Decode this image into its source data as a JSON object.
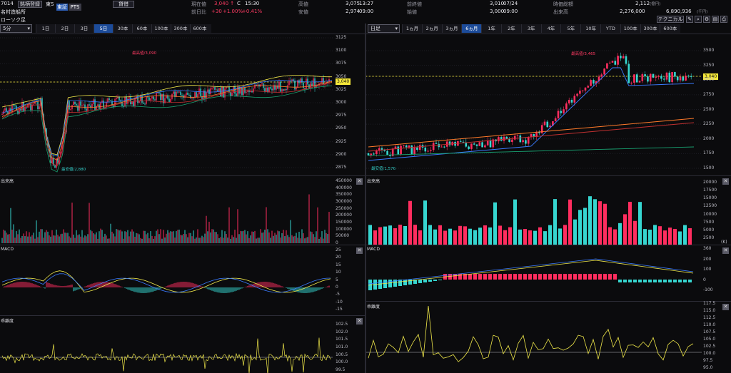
{
  "header": {
    "code": "7014",
    "company": "名村造船所",
    "register_button": "銘柄登録",
    "exchange": "東S",
    "market_tag": "東証",
    "pts_tag": "PTS",
    "lend_button": "貸借",
    "chart_type_label": "ローソク足",
    "fields": {
      "current_label": "現在値",
      "current_value": "3,040 ↑",
      "current_time_code": "C",
      "current_time": "15:30",
      "change_label": "前日比",
      "change_value": "+30",
      "change_pct": "+1.00%",
      "change_pct2": "+0.41%",
      "high_label": "高値",
      "high_value": "3,075",
      "high_time": "13:27",
      "low_label": "安値",
      "low_value": "2,974",
      "low_time": "09:00",
      "prev_label": "前終値",
      "prev_value": "3,010",
      "prev_date": "07/24",
      "open_label": "始値",
      "open_value": "3,000",
      "open_time": "09:00",
      "mcap_label": "時価総額",
      "mcap_value": "2,112",
      "mcap_unit": "(億円)",
      "volume_label": "出来高",
      "volume_value": "2,276,000",
      "turnover_value": "6,890,936",
      "turnover_unit": "(千円)",
      "technical_button": "テクニカル"
    }
  },
  "left": {
    "interval_select": "5分",
    "periods": [
      "1日",
      "2日",
      "3日",
      "5日",
      "30本",
      "60本",
      "100本",
      "300本",
      "600本"
    ],
    "active_period": "5日",
    "price_ticks": [
      "3125",
      "3100",
      "3075",
      "3050",
      "3025",
      "3000",
      "2975",
      "2950",
      "2925",
      "2900",
      "2875"
    ],
    "high_annotation": "最高値/3,090",
    "low_annotation": "最安値/2,880",
    "current_tag": "3,040",
    "volume_title": "出来高",
    "volume_ticks": [
      "450000",
      "400000",
      "350000",
      "300000",
      "250000",
      "200000",
      "150000",
      "100000",
      "50000",
      "0"
    ],
    "macd_title": "MACD",
    "macd_ticks": [
      "25",
      "20",
      "15",
      "10",
      "5",
      "0",
      "-5",
      "-10",
      "-15"
    ],
    "dev_title": "乖離度",
    "dev_ticks": [
      "102.5",
      "102.0",
      "101.5",
      "101.0",
      "100.5",
      "100.0",
      "99.5"
    ]
  },
  "right": {
    "interval_select": "日足",
    "periods": [
      "1ヵ月",
      "2ヵ月",
      "3ヵ月",
      "6ヵ月",
      "1年",
      "2年",
      "3年",
      "4年",
      "5年",
      "10年",
      "YTD",
      "100本",
      "300本",
      "600本"
    ],
    "active_period": "6ヵ月",
    "price_ticks": [
      "3500",
      "3250",
      "3000",
      "2750",
      "2500",
      "2250",
      "2000",
      "1750",
      "1500"
    ],
    "high_annotation": "最高値/3,465",
    "low_annotation": "最安値/1,576",
    "current_tag": "3,040",
    "volume_title": "出来高",
    "volume_ticks": [
      "20000",
      "17500",
      "15000",
      "12500",
      "10000",
      "7500",
      "5000",
      "2500"
    ],
    "volume_unit": "(K)",
    "macd_title": "MACD",
    "macd_ticks": [
      "360",
      "200",
      "100",
      "0",
      "-100"
    ],
    "dev_title": "乖離度",
    "dev_ticks": [
      "117.5",
      "115.0",
      "112.5",
      "110.0",
      "107.5",
      "105.0",
      "102.5",
      "100.0",
      "97.5",
      "95.0"
    ]
  },
  "close_label": "✕",
  "colors": {
    "up": "#ff2d5f",
    "down": "#36d6d0",
    "accent": "#1d4c9a",
    "tag": "#f5e83a"
  }
}
